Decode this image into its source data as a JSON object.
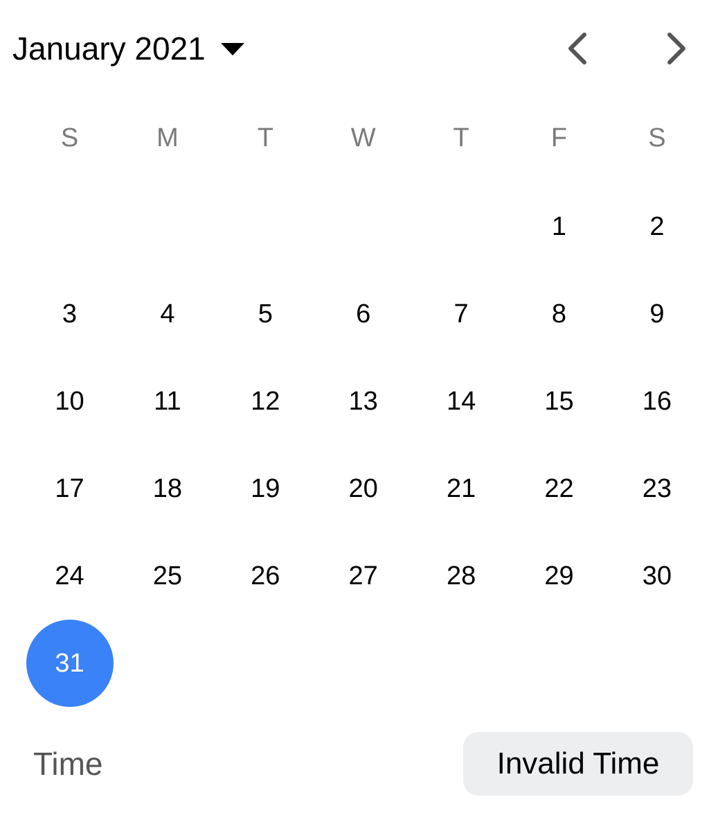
{
  "header": {
    "month_label": "January 2021",
    "caret_icon": "caret-down-icon",
    "prev_icon": "chevron-left-icon",
    "next_icon": "chevron-right-icon"
  },
  "weekdays": [
    "S",
    "M",
    "T",
    "W",
    "T",
    "F",
    "S"
  ],
  "month": {
    "leading_blank_days": 5,
    "days": [
      "1",
      "2",
      "3",
      "4",
      "5",
      "6",
      "7",
      "8",
      "9",
      "10",
      "11",
      "12",
      "13",
      "14",
      "15",
      "16",
      "17",
      "18",
      "19",
      "20",
      "21",
      "22",
      "23",
      "24",
      "25",
      "26",
      "27",
      "28",
      "29",
      "30",
      "31"
    ],
    "selected_day": "31"
  },
  "time": {
    "label": "Time",
    "value": "Invalid Time"
  },
  "colors": {
    "accent": "#3a82f7",
    "weekday_text": "#7a7a7a",
    "time_button_bg": "#eceef0"
  }
}
